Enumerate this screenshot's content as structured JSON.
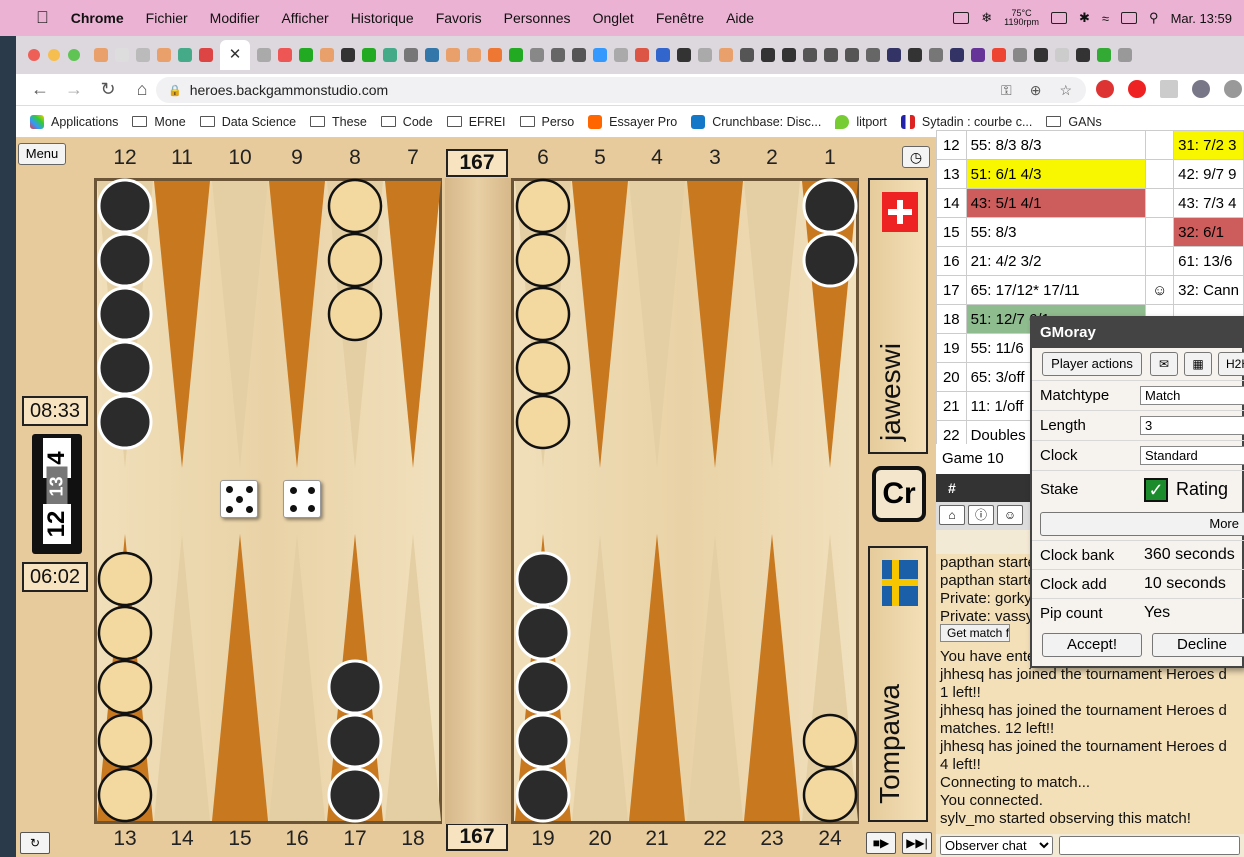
{
  "menubar": {
    "apple": "",
    "items": [
      "Chrome",
      "Fichier",
      "Modifier",
      "Afficher",
      "Historique",
      "Favoris",
      "Personnes",
      "Onglet",
      "Fenêtre",
      "Aide"
    ],
    "temp_line1": "75°C",
    "temp_line2": "1190rpm",
    "clock": "Mar. 13:59"
  },
  "browser": {
    "url": "heroes.backgammonstudio.com",
    "bookmarks": [
      "Applications",
      "Mone",
      "Data Science",
      "These",
      "Code",
      "EFREI",
      "Perso",
      "Essayer Pro",
      "Crunchbase: Disc...",
      "litport",
      "Sytadin : courbe c...",
      "GANs"
    ]
  },
  "board": {
    "menu_label": "Menu",
    "top_points": [
      "12",
      "11",
      "10",
      "9",
      "8",
      "7",
      "6",
      "5",
      "4",
      "3",
      "2",
      "1"
    ],
    "bottom_points": [
      "13",
      "14",
      "15",
      "16",
      "17",
      "18",
      "19",
      "20",
      "21",
      "22",
      "23",
      "24"
    ],
    "pip_top": "167",
    "pip_bottom": "167",
    "timer_top": "08:33",
    "timer_bottom": "06:02",
    "cube_values": [
      "4",
      "13",
      "12"
    ],
    "dice": [
      5,
      4
    ],
    "player_top": "jaweswi",
    "player_bottom": "Tompawa",
    "center_label": "Cr",
    "flag_top": "swiss-flag",
    "flag_bottom": "swedish-flag"
  },
  "moves": [
    {
      "n": "12",
      "a": "55: 8/3 8/3",
      "s": "",
      "b": "31: 7/2 3"
    },
    {
      "n": "13",
      "a": "51: 6/1 4/3",
      "s": "",
      "b": "42: 9/7 9"
    },
    {
      "n": "14",
      "a": "43: 5/1 4/1",
      "s": "",
      "b": "43: 7/3 4"
    },
    {
      "n": "15",
      "a": "55: 8/3",
      "s": "",
      "b": "32: 6/1"
    },
    {
      "n": "16",
      "a": "21: 4/2 3/2",
      "s": "",
      "b": "61: 13/6"
    },
    {
      "n": "17",
      "a": "65: 17/12* 17/11",
      "s": "☺",
      "b": "32: Cann"
    },
    {
      "n": "18",
      "a": "51: 12/7 6/1",
      "s": "",
      "b": ""
    },
    {
      "n": "19",
      "a": "55: 11/6",
      "s": "",
      "b": ""
    },
    {
      "n": "20",
      "a": "65: 3/off",
      "s": "",
      "b": ""
    },
    {
      "n": "21",
      "a": "11: 1/off",
      "s": "",
      "b": ""
    },
    {
      "n": "22",
      "a": "Doubles",
      "s": "",
      "b": ""
    }
  ],
  "game_label": "Game 10",
  "hash_label": "#",
  "chat": {
    "lines": [
      "papthan started",
      "papthan started",
      "Private: gorky",
      "Private: vassy",
      "You have entered",
      "jhhesq has joined the tournament Heroes d",
      "1 left!!",
      "jhhesq has joined the tournament Heroes d",
      "matches. 12 left!!",
      "jhhesq has joined the tournament Heroes d",
      "4 left!!",
      "Connecting to match...",
      "You connected.",
      "sylv_mo started observing this match!"
    ],
    "get_match_file": "Get match file",
    "channel": "Observer chat",
    "input_placeholder": ""
  },
  "dialog": {
    "title": "GMoray",
    "player_actions": "Player actions",
    "h2h": "H2H",
    "rows": [
      {
        "k": "Matchtype",
        "v": "Match"
      },
      {
        "k": "Length",
        "v": "3"
      },
      {
        "k": "Clock",
        "v": "Standard"
      }
    ],
    "stake_label": "Stake",
    "stake_value": "Rating",
    "more": "More",
    "info": [
      {
        "k": "Clock bank",
        "v": "360 seconds"
      },
      {
        "k": "Clock add",
        "v": "10 seconds"
      },
      {
        "k": "Pip count",
        "v": "Yes"
      }
    ],
    "accept": "Accept!",
    "decline": "Decline"
  }
}
